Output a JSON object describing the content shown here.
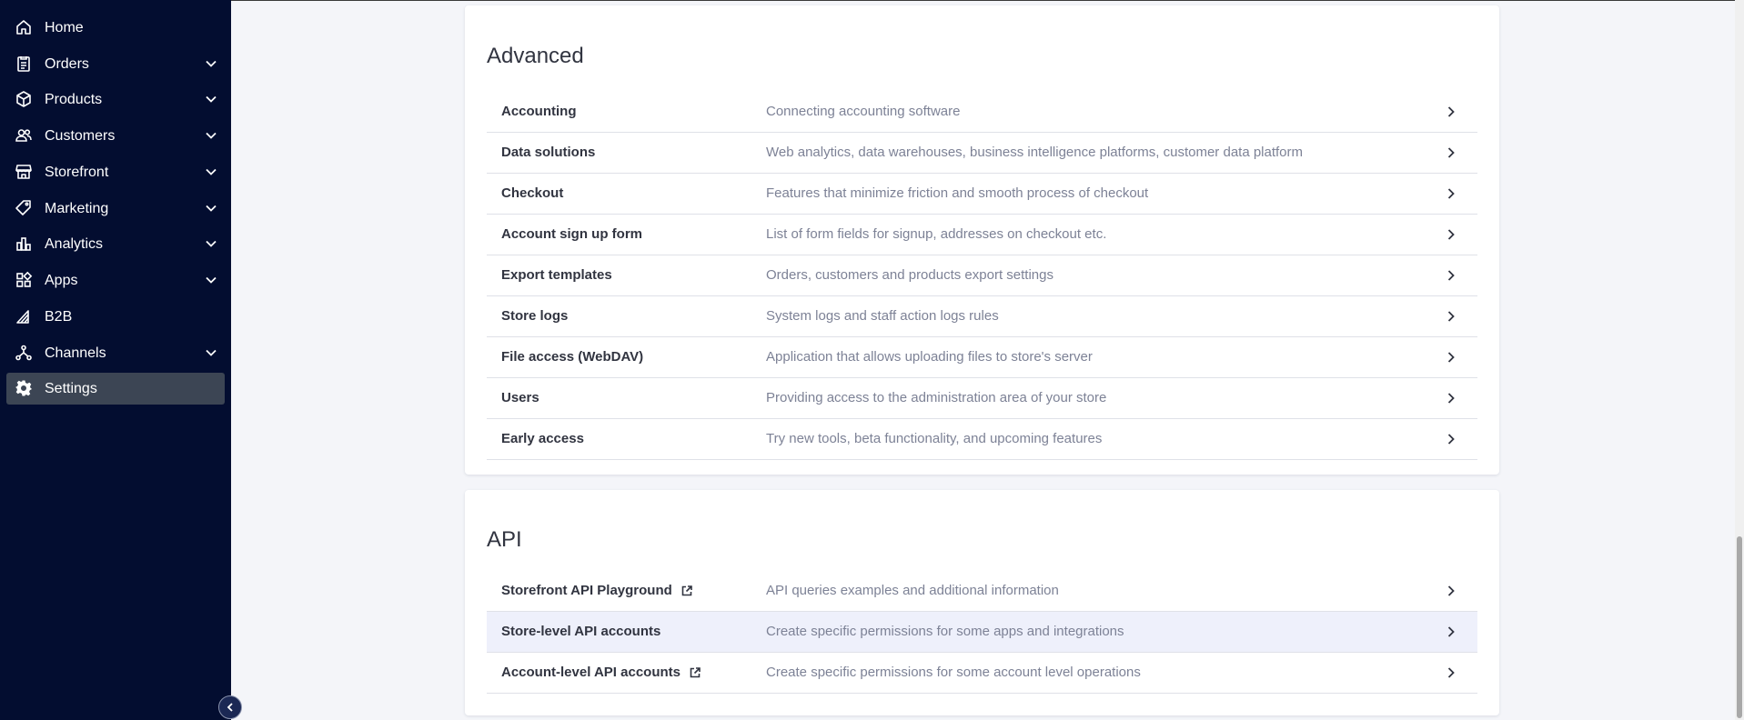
{
  "sidebar": {
    "items": [
      {
        "label": "Home",
        "icon": "home-icon",
        "has_chevron": false
      },
      {
        "label": "Orders",
        "icon": "orders-icon",
        "has_chevron": true
      },
      {
        "label": "Products",
        "icon": "box-icon",
        "has_chevron": true
      },
      {
        "label": "Customers",
        "icon": "users-icon",
        "has_chevron": true
      },
      {
        "label": "Storefront",
        "icon": "storefront-icon",
        "has_chevron": true
      },
      {
        "label": "Marketing",
        "icon": "tag-icon",
        "has_chevron": true
      },
      {
        "label": "Analytics",
        "icon": "bar-chart-icon",
        "has_chevron": true
      },
      {
        "label": "Apps",
        "icon": "apps-grid-icon",
        "has_chevron": true
      },
      {
        "label": "B2B",
        "icon": "b2b-icon",
        "has_chevron": false
      },
      {
        "label": "Channels",
        "icon": "channels-icon",
        "has_chevron": true
      },
      {
        "label": "Settings",
        "icon": "gear-icon",
        "has_chevron": false,
        "active": true
      }
    ]
  },
  "advanced": {
    "title": "Advanced",
    "rows": [
      {
        "title": "Accounting",
        "desc": "Connecting accounting software"
      },
      {
        "title": "Data solutions",
        "desc": "Web analytics, data warehouses, business intelligence platforms, customer data platform"
      },
      {
        "title": "Checkout",
        "desc": "Features that minimize friction and smooth process of checkout"
      },
      {
        "title": "Account sign up form",
        "desc": "List of form fields for signup, addresses on checkout etc."
      },
      {
        "title": "Export templates",
        "desc": "Orders, customers and products export settings"
      },
      {
        "title": "Store logs",
        "desc": "System logs and staff action logs rules"
      },
      {
        "title": "File access (WebDAV)",
        "desc": "Application that allows uploading files to store's server"
      },
      {
        "title": "Users",
        "desc": "Providing access to the administration area of your store"
      },
      {
        "title": "Early access",
        "desc": "Try new tools, beta functionality, and upcoming features"
      }
    ]
  },
  "api": {
    "title": "API",
    "rows": [
      {
        "title": "Storefront API Playground",
        "desc": "API queries examples and additional information",
        "external": true
      },
      {
        "title": "Store-level API accounts",
        "desc": "Create specific permissions for some apps and integrations",
        "highlight": true
      },
      {
        "title": "Account-level API accounts",
        "desc": "Create specific permissions for some account level operations",
        "external": true
      }
    ]
  },
  "colors": {
    "sidebar_bg": "#030d30",
    "sidebar_active": "#3c4554",
    "row_highlight": "#eef0fb"
  }
}
